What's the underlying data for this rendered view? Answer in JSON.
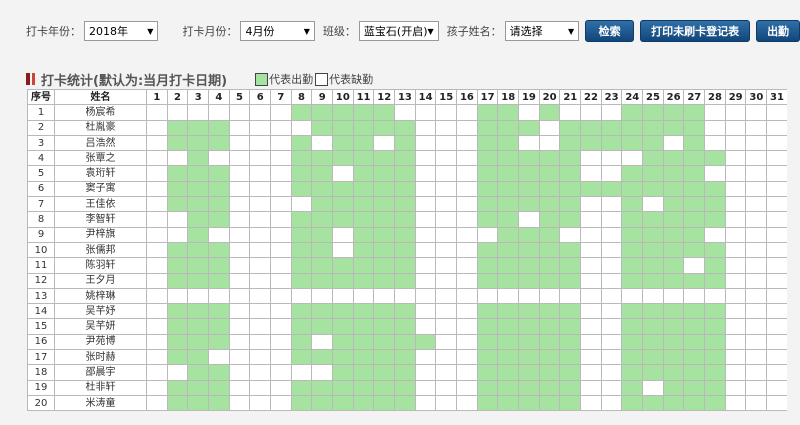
{
  "toolbar": {
    "year_label": "打卡年份：",
    "year_value": "2018年",
    "month_label": "打卡月份：",
    "month_value": "4月份",
    "class_label": "班级：",
    "class_value": "蓝宝石(开启)",
    "child_label": "孩子姓名：",
    "child_value": "请选择",
    "search_button": "检索",
    "print_button": "打印未刷卡登记表",
    "export_button": "出勤"
  },
  "section": {
    "title": "打卡统计(默认为:当月打卡日期)",
    "legend_present": "代表出勤",
    "legend_absent": "代表缺勤"
  },
  "colors": {
    "present": "#a7e3a0",
    "absent": "#ffffff",
    "button": "#1c5690"
  },
  "table": {
    "col_index": "序号",
    "col_name": "姓名",
    "days": [
      "1",
      "2",
      "3",
      "4",
      "5",
      "6",
      "7",
      "8",
      "9",
      "10",
      "11",
      "12",
      "13",
      "14",
      "15",
      "16",
      "17",
      "18",
      "19",
      "20",
      "21",
      "22",
      "23",
      "24",
      "25",
      "26",
      "27",
      "28",
      "29",
      "30",
      "31"
    ]
  },
  "rows": [
    {
      "index": "1",
      "name": "杨宸希",
      "att": "0000000111110000110100011110000"
    },
    {
      "index": "2",
      "name": "杜胤豪",
      "att": "0111000011111000111011111110000"
    },
    {
      "index": "3",
      "name": "吕浩然",
      "att": "0111000101101000110011111010000"
    },
    {
      "index": "4",
      "name": "张覃之",
      "att": "0010000111111000111110001111000"
    },
    {
      "index": "5",
      "name": "袁珩轩",
      "att": "0111000110111000111110011110000"
    },
    {
      "index": "6",
      "name": "窦子寓",
      "att": "0111000111111000111111111111000"
    },
    {
      "index": "7",
      "name": "王佳依",
      "att": "0111000011111000111110010111000"
    },
    {
      "index": "8",
      "name": "李智轩",
      "att": "0011000111111000110110011111000"
    },
    {
      "index": "9",
      "name": "尹梓旗",
      "att": "0010000110111000011100011110000"
    },
    {
      "index": "10",
      "name": "张儒邦",
      "att": "0111000110111000111110011111000"
    },
    {
      "index": "11",
      "name": "陈羽轩",
      "att": "0111000111111000111110011101000"
    },
    {
      "index": "12",
      "name": "王夕月",
      "att": "0111000111111000111110011111000"
    },
    {
      "index": "13",
      "name": "姚梓琳",
      "att": "0000000000000000000000000000000"
    },
    {
      "index": "14",
      "name": "吴芊妤",
      "att": "0111000111111000111110011111000"
    },
    {
      "index": "15",
      "name": "吴芊妍",
      "att": "0111000111111000111110011111000"
    },
    {
      "index": "16",
      "name": "尹苑博",
      "att": "0111000101111100111110011111000"
    },
    {
      "index": "17",
      "name": "张时赫",
      "att": "0110000111111000111110011111000"
    },
    {
      "index": "18",
      "name": "邵晨宇",
      "att": "0011000001111000111110011111000"
    },
    {
      "index": "19",
      "name": "杜非轩",
      "att": "0111000111111000111110010111000"
    },
    {
      "index": "20",
      "name": "米涛童",
      "att": "0111000111111000111110011111000"
    }
  ]
}
